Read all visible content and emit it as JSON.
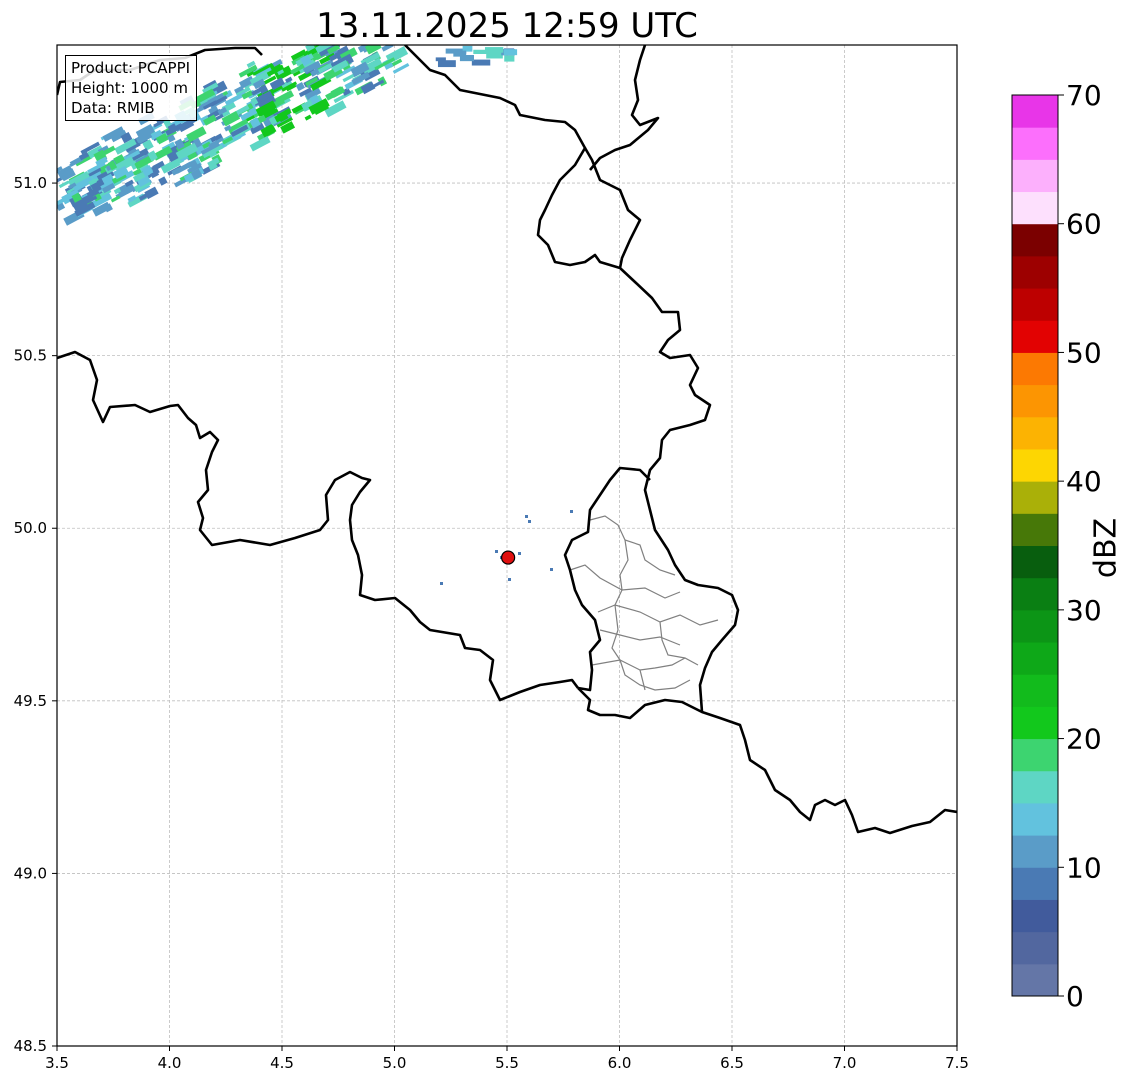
{
  "title": "13.11.2025 12:59 UTC",
  "info": {
    "product": "Product: PCAPPI",
    "height": "Height: 1000 m",
    "data": "Data: RMIB"
  },
  "axes": {
    "x_ticks": [
      "3.5",
      "4.0",
      "4.5",
      "5.0",
      "5.5",
      "6.0",
      "6.5",
      "7.0",
      "7.5"
    ],
    "y_ticks": [
      "48.5",
      "49.0",
      "49.5",
      "50.0",
      "50.5",
      "51.0"
    ],
    "lon_range": [
      3.5,
      7.5
    ],
    "lat_range": [
      48.5,
      51.4
    ],
    "grid": true
  },
  "colorbar": {
    "label": "dBZ",
    "ticks": [
      "0",
      "10",
      "20",
      "30",
      "40",
      "50",
      "60",
      "70"
    ],
    "range": [
      0,
      70
    ],
    "step": 2.5,
    "colors": [
      "#6476a7",
      "#52679f",
      "#415b9c",
      "#4a7ab4",
      "#5a9cc8",
      "#62c2de",
      "#5ed6c4",
      "#3dd470",
      "#12c81c",
      "#12bb1c",
      "#0ea818",
      "#0c9516",
      "#0a7f13",
      "#085e0e",
      "#477808",
      "#aab008",
      "#fdd602",
      "#fcb302",
      "#fc9502",
      "#fc7902",
      "#e20202",
      "#bd0000",
      "#9d0000",
      "#7b0000",
      "#fde0fd",
      "#fcb0fc",
      "#fc6ffc",
      "#e835e8"
    ]
  },
  "radar_site": {
    "lon": 5.505,
    "lat": 49.915,
    "color": "#e01010"
  },
  "colors": {
    "border": "#000000",
    "admin": "#808080",
    "grid": "#bfbfbf"
  }
}
